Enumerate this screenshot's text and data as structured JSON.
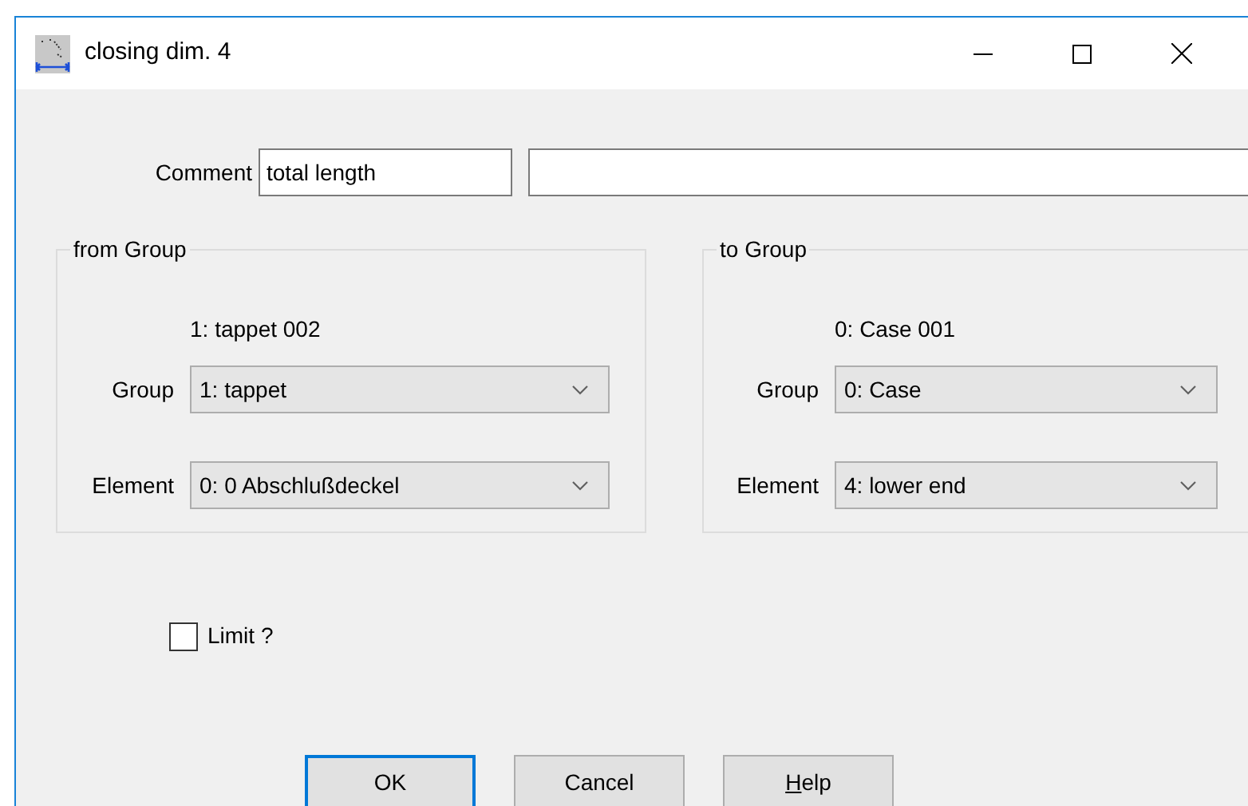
{
  "window": {
    "title": "closing dim. 4"
  },
  "comment": {
    "label": "Comment",
    "value": "total length"
  },
  "groups": [
    {
      "legend": "from Group",
      "current": "1: tappet 002",
      "fields": [
        {
          "label": "Group",
          "value": "1: tappet"
        },
        {
          "label": "Element",
          "value": "0: 0 Abschlußdeckel"
        }
      ]
    },
    {
      "legend": "to Group",
      "current": "0: Case 001",
      "fields": [
        {
          "label": "Group",
          "value": "0: Case"
        },
        {
          "label": "Element",
          "value": "4: lower end"
        }
      ]
    }
  ],
  "limit": {
    "label": "Limit ?",
    "checked": false
  },
  "buttons": [
    {
      "label": "OK",
      "default": true,
      "mnemonic_underlined": false
    },
    {
      "label": "Cancel",
      "default": false,
      "mnemonic_underlined": false
    },
    {
      "label": "Help",
      "default": false,
      "mnemonic_underlined": true
    }
  ]
}
